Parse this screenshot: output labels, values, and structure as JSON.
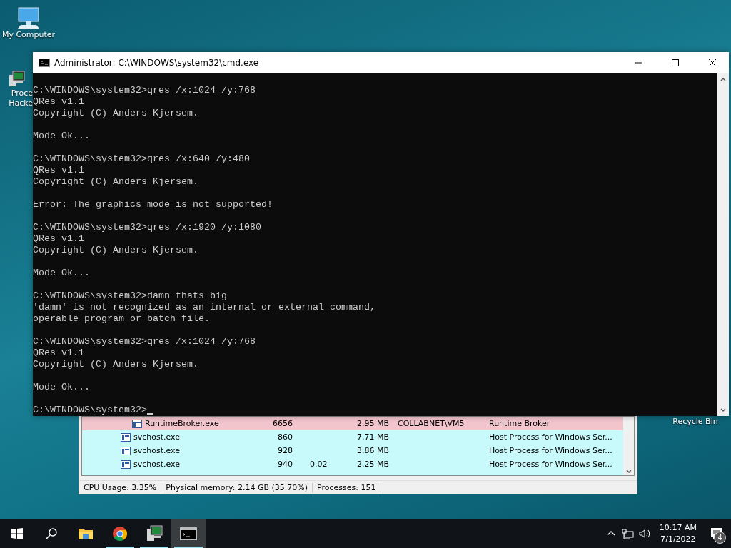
{
  "desktop_icons": [
    {
      "kind": "computer",
      "lines": [
        "My Computer"
      ]
    },
    {
      "kind": "hacker",
      "lines": [
        "Proce",
        "Hacke"
      ]
    },
    {
      "kind": "bin",
      "lines": [
        "Recycle Bin"
      ]
    }
  ],
  "process_window": {
    "rows": [
      {
        "kind": "child",
        "name": "RuntimeBroker.exe",
        "pid": "6656",
        "cpu": "",
        "private": "2.95 MB",
        "user": "COLLABNET\\VM5",
        "description": "Runtime Broker",
        "color": "#f2c4cc"
      },
      {
        "kind": "top",
        "name": "svchost.exe",
        "pid": "860",
        "cpu": "",
        "private": "7.71 MB",
        "user": "",
        "description": "Host Process for Windows Ser...",
        "color": "#c8f9fb"
      },
      {
        "kind": "top",
        "name": "svchost.exe",
        "pid": "928",
        "cpu": "",
        "private": "3.86 MB",
        "user": "",
        "description": "Host Process for Windows Ser...",
        "color": "#c8f9fb"
      },
      {
        "kind": "top",
        "name": "svchost.exe",
        "pid": "940",
        "cpu": "0.02",
        "private": "2.25 MB",
        "user": "",
        "description": "Host Process for Windows Ser...",
        "color": "#c8f9fb"
      }
    ],
    "status_bar": [
      "CPU Usage: 3.35%",
      "Physical memory: 2.14 GB (35.70%)",
      "Processes: 151"
    ]
  },
  "console_window": {
    "title": "Administrator: C:\\WINDOWS\\system32\\cmd.exe",
    "blocks": [
      [
        "C:\\WINDOWS\\system32>qres /x:1024 /y:768",
        "QRes v1.1",
        "Copyright (C) Anders Kjersem."
      ],
      [
        "Mode Ok..."
      ],
      [
        "C:\\WINDOWS\\system32>qres /x:640 /y:480",
        "QRes v1.1",
        "Copyright (C) Anders Kjersem."
      ],
      [
        "Error: The graphics mode is not supported!"
      ],
      [
        "C:\\WINDOWS\\system32>qres /x:1920 /y:1080",
        "QRes v1.1",
        "Copyright (C) Anders Kjersem."
      ],
      [
        "Mode Ok..."
      ],
      [
        "C:\\WINDOWS\\system32>damn thats big",
        "'damn' is not recognized as an internal or external command,",
        "operable program or batch file."
      ],
      [
        "C:\\WINDOWS\\system32>qres /x:1024 /y:768",
        "QRes v1.1",
        "Copyright (C) Anders Kjersem."
      ],
      [
        "Mode Ok..."
      ],
      [
        "C:\\WINDOWS\\system32>"
      ]
    ]
  },
  "taskbar": {
    "apps": [
      {
        "kind": "explorer",
        "running": false,
        "selected": false
      },
      {
        "kind": "chrome",
        "running": true,
        "selected": false
      },
      {
        "kind": "hacker",
        "running": true,
        "selected": false
      },
      {
        "kind": "console",
        "running": true,
        "selected": true
      }
    ],
    "time": "10:17 AM",
    "date": "7/1/2022",
    "notification_count": "4"
  }
}
